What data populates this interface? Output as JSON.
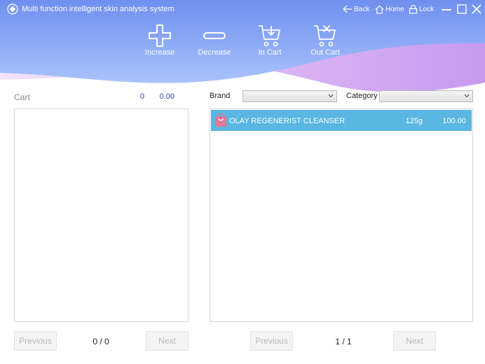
{
  "app": {
    "title": "Multi function intelligent skin analysis system",
    "window_controls": {
      "back": "Back",
      "home": "Home",
      "lock": "Lock"
    }
  },
  "toolbar": {
    "increase": "Increase",
    "decrease": "Decrease",
    "in_cart": "In Cart",
    "out_cart": "Out Cart"
  },
  "cart": {
    "title": "Cart",
    "count": "0",
    "total": "0.00",
    "items": [],
    "pagination": {
      "previous": "Previous",
      "info": "0 / 0",
      "next": "Next"
    }
  },
  "filters": {
    "brand_label": "Brand",
    "brand_value": "",
    "category_label": "Category",
    "category_value": ""
  },
  "products": {
    "items": [
      {
        "name": "OLAY REGENERIST CLEANSER",
        "size": "125g",
        "price": "100.00"
      }
    ],
    "pagination": {
      "previous": "Previous",
      "info": "1 / 1",
      "next": "Next"
    }
  },
  "colors": {
    "header_blue": "#7f9bf2",
    "wave_pink": "#d3aaf0",
    "selection": "#5ab6e2",
    "accent_text": "#3a3ab5"
  }
}
